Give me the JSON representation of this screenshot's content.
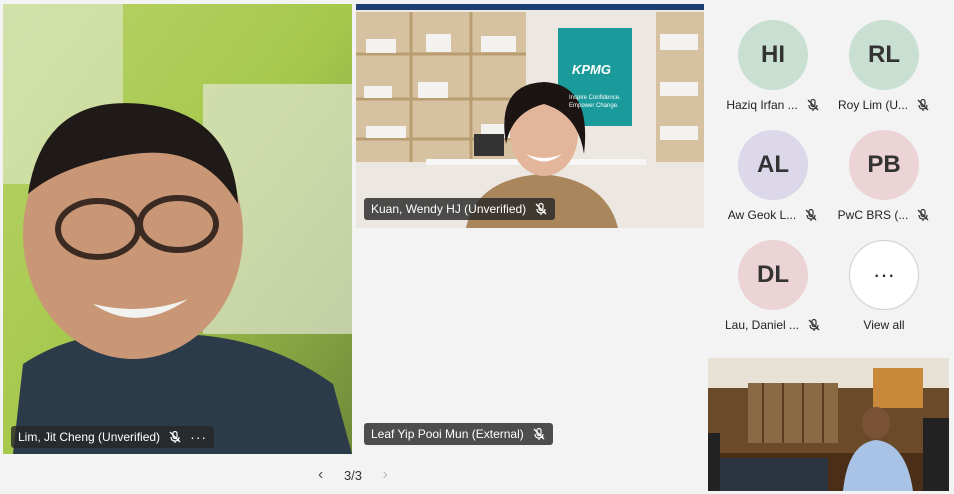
{
  "participants": {
    "main": {
      "name": "Lim, Jit Cheng (Unverified)",
      "more": "···"
    },
    "wendy": {
      "name": "Kuan, Wendy HJ (Unverified)",
      "logo": "KPMG",
      "slogan1": "Inspire Confidence.",
      "slogan2": "Empower Change."
    },
    "leaf": {
      "name": "Leaf Yip Pooi Mun (External)"
    }
  },
  "roster": [
    {
      "initials": "HI",
      "label": "Haziq Irfan ...",
      "color": "#c9dfd2"
    },
    {
      "initials": "RL",
      "label": "Roy Lim (U...",
      "color": "#c9dfd2"
    },
    {
      "initials": "AL",
      "label": "Aw Geok L...",
      "color": "#dcd8ea"
    },
    {
      "initials": "PB",
      "label": "PwC BRS (...",
      "color": "#ecd3d6"
    },
    {
      "initials": "DL",
      "label": "Lau, Daniel ...",
      "color": "#ecd3d6"
    }
  ],
  "view_all": {
    "glyph": "···",
    "label": "View all"
  },
  "pager": {
    "text": "3/3",
    "prev": "‹",
    "next": "›"
  }
}
